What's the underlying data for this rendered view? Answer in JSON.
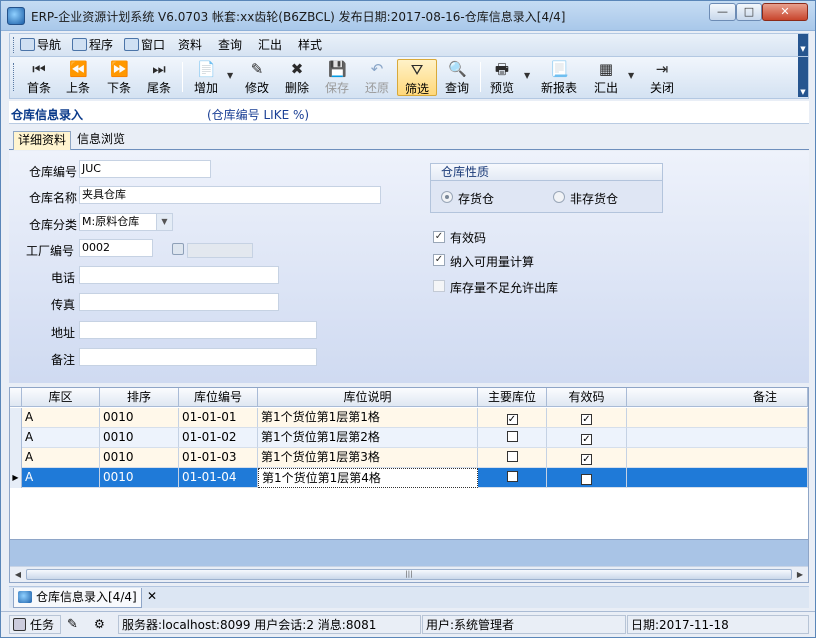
{
  "window": {
    "title": "ERP-企业资源计划系统 V6.0703 帐套:xx齿轮(B6ZBCL) 发布日期:2017-08-16-仓库信息录入[4/4]",
    "min": "—",
    "max": "□",
    "close": "✕"
  },
  "menu": [
    "导航",
    "程序",
    "窗口",
    "资料",
    "查询",
    "汇出",
    "样式"
  ],
  "toolbar": {
    "first": "首条",
    "prev": "上条",
    "next": "下条",
    "last": "尾条",
    "add": "增加",
    "edit": "修改",
    "delete": "删除",
    "save": "保存",
    "restore": "还原",
    "filter": "筛选",
    "query": "查询",
    "preview": "预览",
    "new_report": "新报表",
    "export": "汇出",
    "close": "关闭"
  },
  "module": {
    "title": "仓库信息录入",
    "filter": "(仓库编号 LIKE %)"
  },
  "tabs": [
    "详细资料",
    "信息浏览"
  ],
  "form": {
    "code_label": "仓库编号",
    "code_value": "JUC",
    "name_label": "仓库名称",
    "name_value": "夹具仓库",
    "class_label": "仓库分类",
    "class_value": "M:原料仓库",
    "factory_label": "工厂编号",
    "factory_value": "0002",
    "phone_label": "电话",
    "phone_value": "",
    "fax_label": "传真",
    "fax_value": "",
    "address_label": "地址",
    "address_value": "",
    "remark_label": "备注",
    "remark_value": "",
    "nature_title": "仓库性质",
    "nature_options": [
      "存货仓",
      "非存货仓"
    ],
    "nature_selected": "存货仓",
    "valid_label": "有效码",
    "valid_checked": true,
    "available_label": "纳入可用量计算",
    "available_checked": true,
    "no_negative_label": "库存量不足允许出库",
    "no_negative_checked": false
  },
  "grid": {
    "columns": [
      "库区",
      "排序",
      "库位编号",
      "库位说明",
      "主要库位",
      "有效码",
      "备注"
    ],
    "rows": [
      {
        "zone": "A",
        "order": "0010",
        "code": "01-01-01",
        "desc": "第1个货位第1层第1格",
        "main": true,
        "valid": true,
        "remark": ""
      },
      {
        "zone": "A",
        "order": "0010",
        "code": "01-01-02",
        "desc": "第1个货位第1层第2格",
        "main": false,
        "valid": true,
        "remark": ""
      },
      {
        "zone": "A",
        "order": "0010",
        "code": "01-01-03",
        "desc": "第1个货位第1层第3格",
        "main": false,
        "valid": true,
        "remark": ""
      },
      {
        "zone": "A",
        "order": "0010",
        "code": "01-01-04",
        "desc": "第1个货位第1层第4格",
        "main": false,
        "valid": true,
        "remark": ""
      }
    ],
    "selected_row": 3
  },
  "doc_tab": {
    "label": "仓库信息录入[4/4]",
    "close": "✕"
  },
  "status": {
    "task": "任务",
    "server": "服务器:localhost:8099 用户会话:2 消息:8081",
    "user": "用户:系统管理者",
    "date": "日期:2017-11-18"
  },
  "colors": {
    "selected_row": "#1f7ad8",
    "row_alt": "#fff8ea",
    "row_plain": "#edf3fc",
    "accent": "#0a3a8a"
  }
}
